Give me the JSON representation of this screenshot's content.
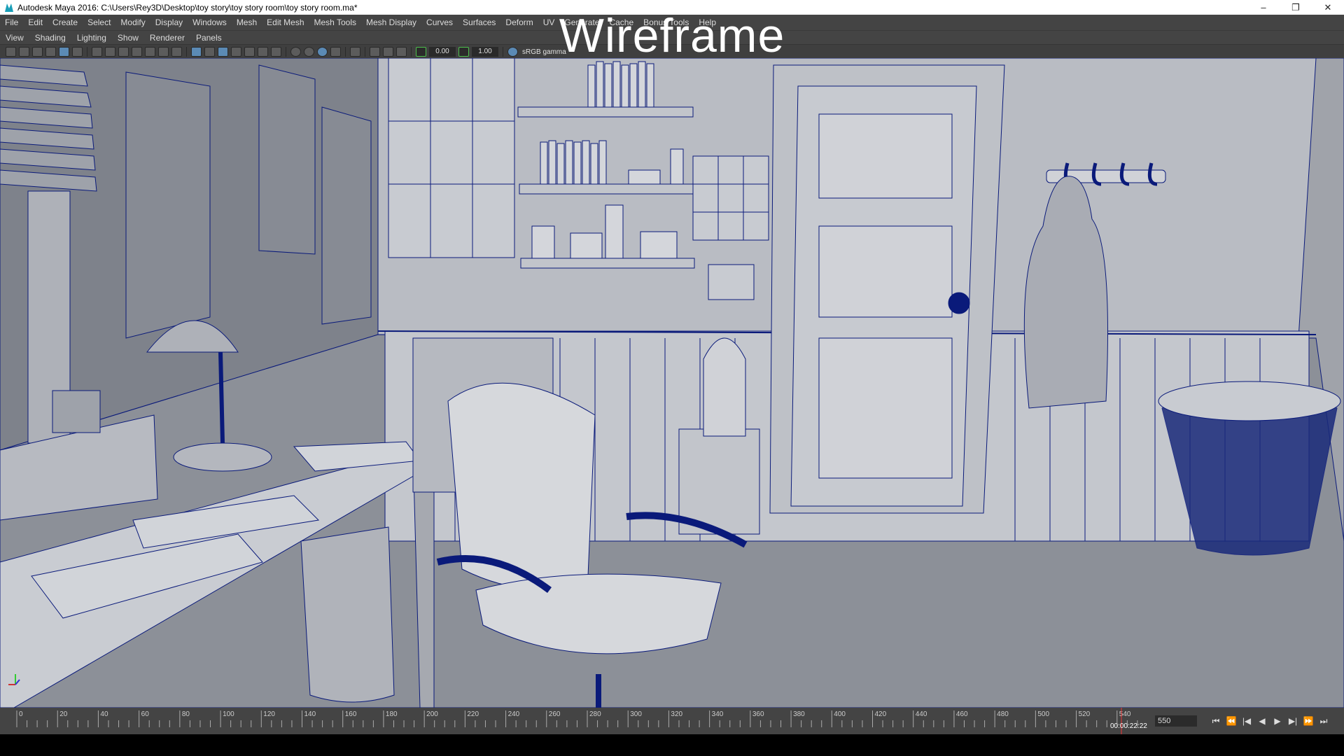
{
  "window": {
    "title": "Autodesk Maya 2016: C:\\Users\\Rey3D\\Desktop\\toy story\\toy story room\\toy story room.ma*",
    "controls": [
      "–",
      "❐",
      "✕"
    ]
  },
  "menubar": {
    "items": [
      "File",
      "Edit",
      "Create",
      "Select",
      "Modify",
      "Display",
      "Windows",
      "Mesh",
      "Edit Mesh",
      "Mesh Tools",
      "Mesh Display",
      "Curves",
      "Surfaces",
      "Deform",
      "UV",
      "Generate",
      "Cache",
      "Bonus Tools",
      "Help"
    ]
  },
  "panel_menu": {
    "items": [
      "View",
      "Shading",
      "Lighting",
      "Show",
      "Renderer",
      "Panels"
    ]
  },
  "toolbar": {
    "exposure": "0.00",
    "gamma": "1.00",
    "color_space": "sRGB gamma"
  },
  "viewport": {
    "overlay_label": "Wireframe",
    "shading_mode": "wireframe-on-shaded",
    "wire_color": "#0a1a7a",
    "bg_color": "#8e929b",
    "axis_labels": [
      "y",
      "x",
      "z"
    ]
  },
  "timeline": {
    "ticks": [
      "0",
      "20",
      "40",
      "60",
      "80",
      "100",
      "120",
      "140",
      "160",
      "180",
      "200",
      "220",
      "240",
      "260",
      "280",
      "300",
      "320",
      "340",
      "360",
      "380",
      "400",
      "420",
      "440",
      "460",
      "480",
      "500",
      "520",
      "540"
    ],
    "current_frame": "550",
    "timecode": "00:00:22:22"
  },
  "playback": {
    "icons": [
      "go-to-start-icon",
      "step-back-key-icon",
      "step-back-frame-icon",
      "play-backward-icon",
      "play-forward-icon",
      "step-forward-frame-icon",
      "step-forward-key-icon",
      "go-to-end-icon"
    ],
    "glyphs": [
      "⏮",
      "⏪",
      "|◀",
      "◀",
      "▶",
      "▶|",
      "⏩",
      "⏭"
    ]
  }
}
